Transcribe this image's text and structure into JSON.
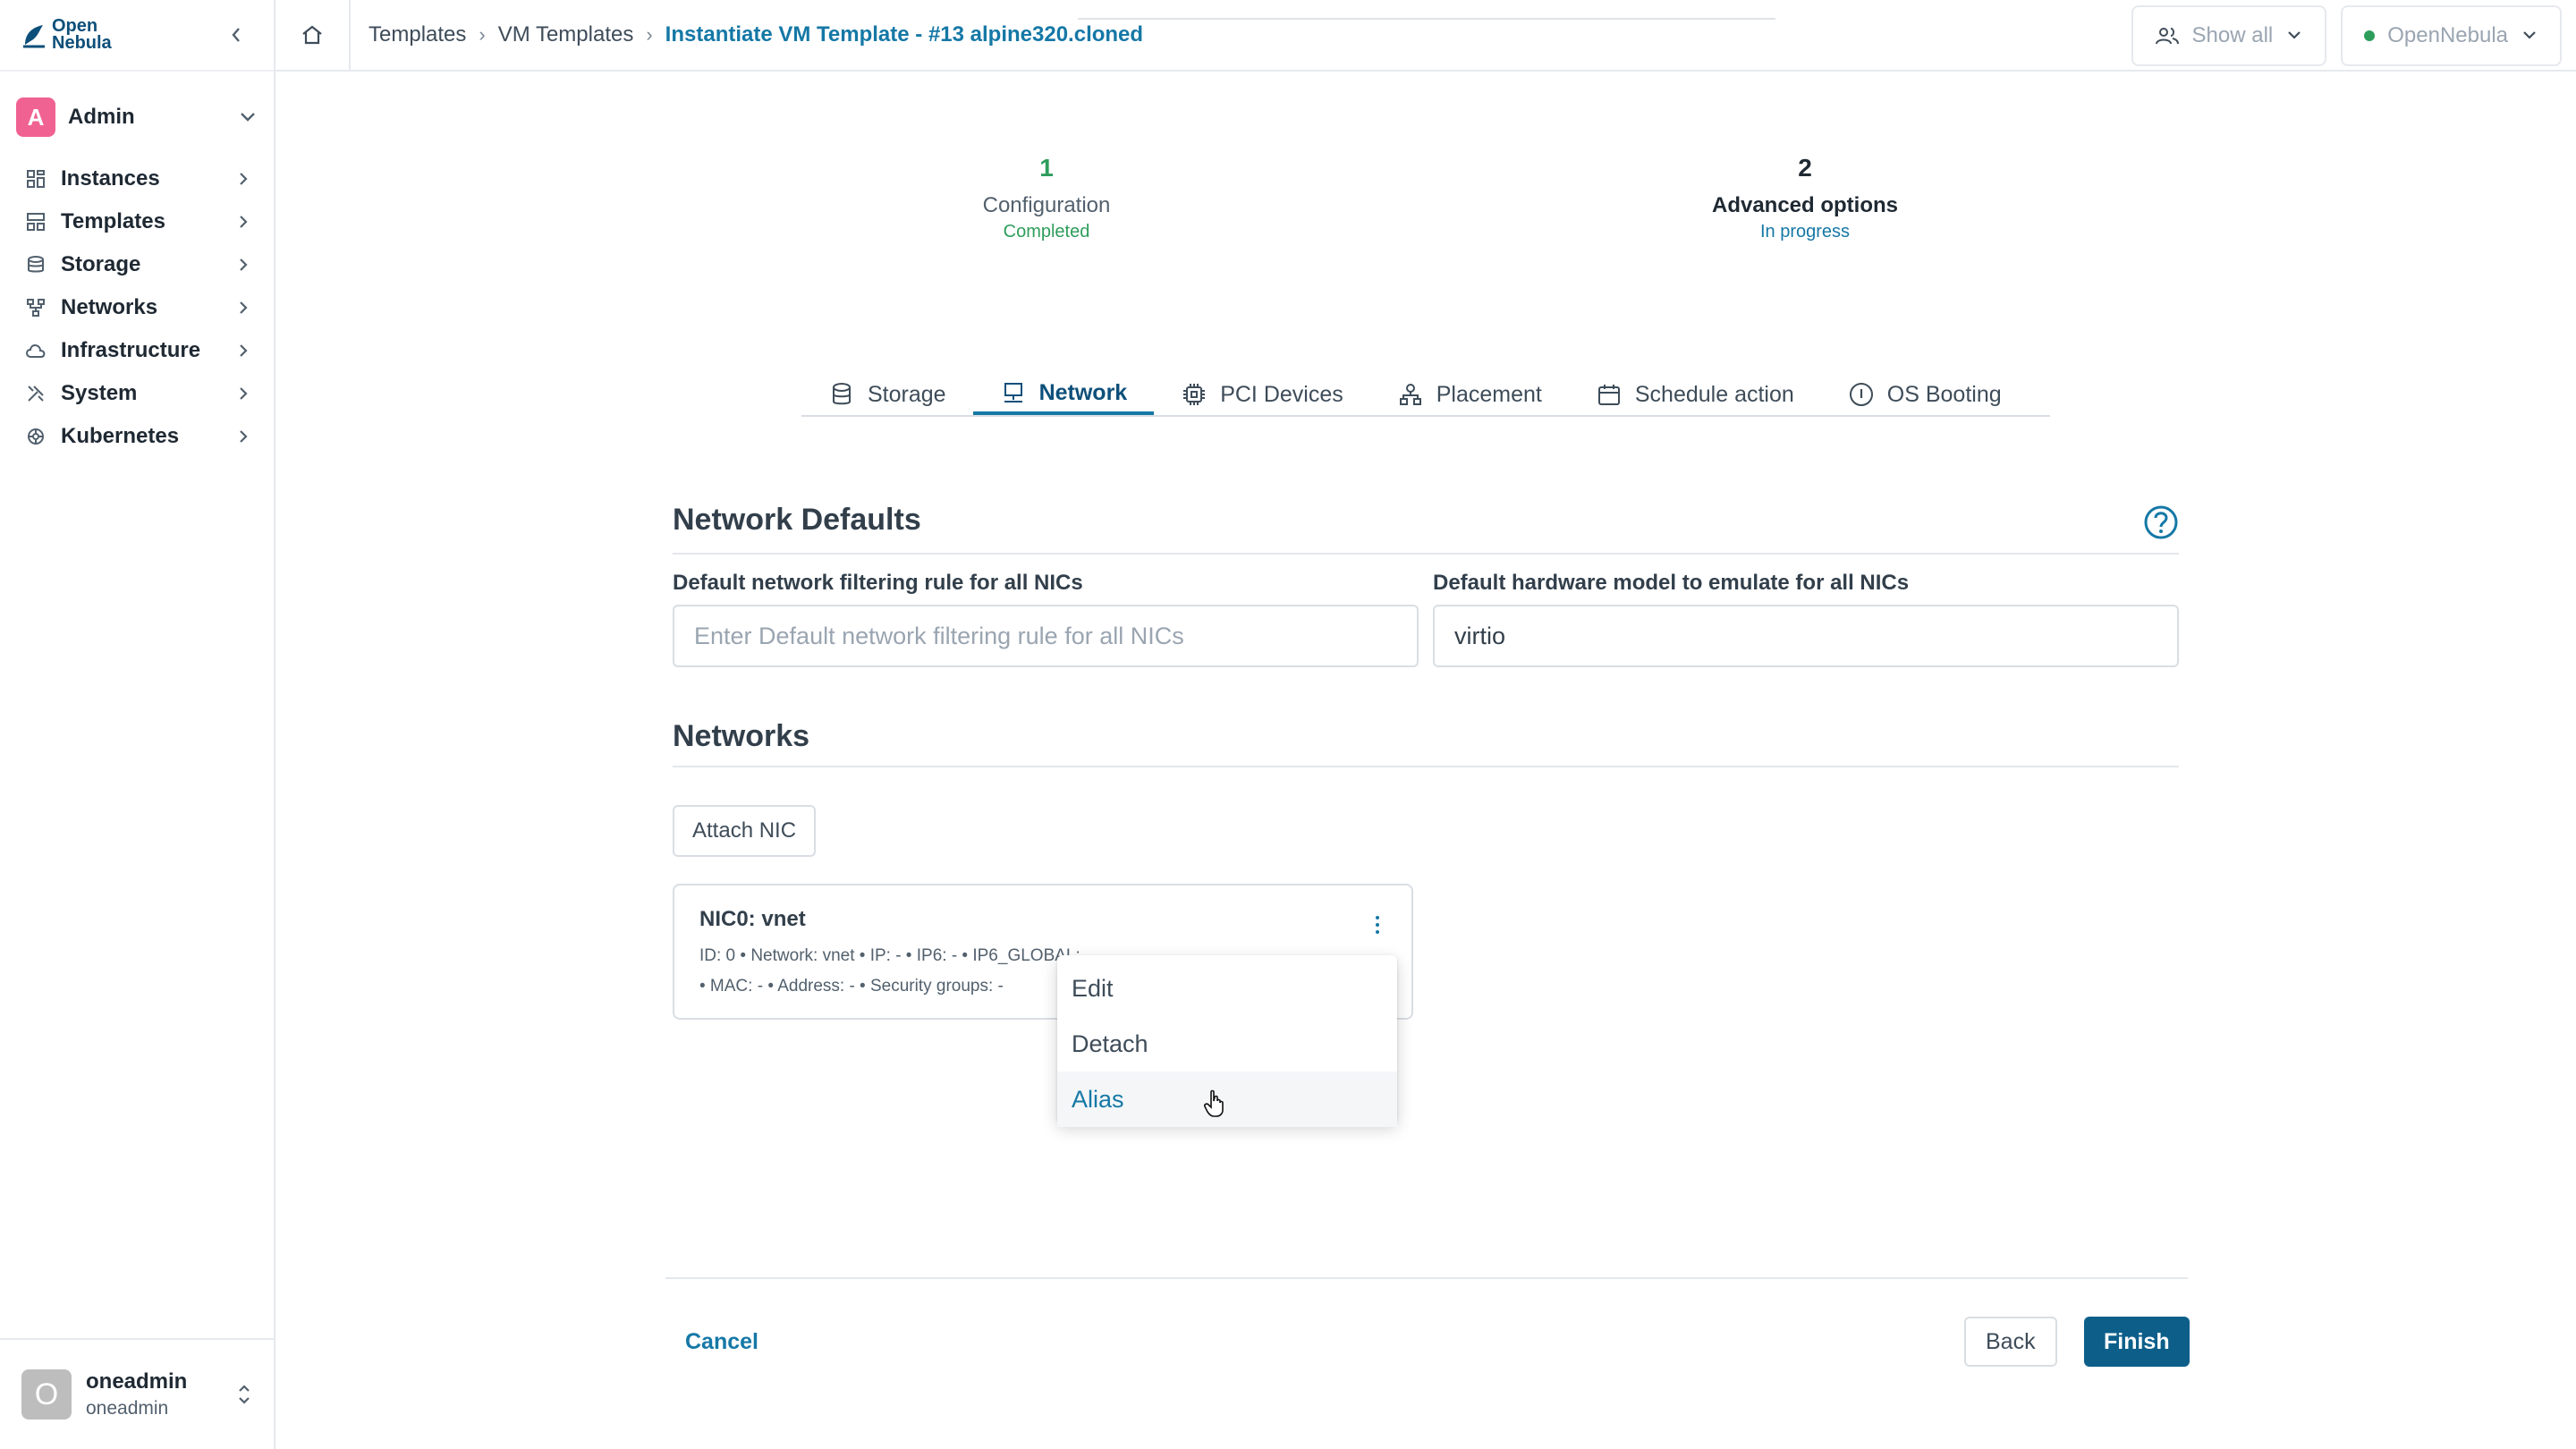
{
  "app": {
    "logo_line1": "Open",
    "logo_line2": "Nebula"
  },
  "sidebar": {
    "group": {
      "initial": "A",
      "name": "Admin"
    },
    "items": [
      {
        "label": "Instances",
        "icon": "grid-icon"
      },
      {
        "label": "Templates",
        "icon": "layout-icon"
      },
      {
        "label": "Storage",
        "icon": "database-icon"
      },
      {
        "label": "Networks",
        "icon": "network-icon"
      },
      {
        "label": "Infrastructure",
        "icon": "cloud-icon"
      },
      {
        "label": "System",
        "icon": "tools-icon"
      },
      {
        "label": "Kubernetes",
        "icon": "helm-icon"
      }
    ],
    "user": {
      "initial": "O",
      "name": "oneadmin",
      "group": "oneadmin"
    }
  },
  "header": {
    "breadcrumb": [
      "Templates",
      "VM Templates",
      "Instantiate VM Template - #13 alpine320.cloned"
    ],
    "view_filter": "Show all",
    "zone": "OpenNebula",
    "zone_status_color": "#2e9d5b"
  },
  "stepper": {
    "steps": [
      {
        "number": "1",
        "title": "Configuration",
        "status": "Completed"
      },
      {
        "number": "2",
        "title": "Advanced options",
        "status": "In progress"
      }
    ]
  },
  "tabs": [
    {
      "label": "Storage",
      "icon": "database-icon"
    },
    {
      "label": "Network",
      "icon": "monitor-network-icon",
      "active": true
    },
    {
      "label": "PCI Devices",
      "icon": "chip-icon"
    },
    {
      "label": "Placement",
      "icon": "hierarchy-icon"
    },
    {
      "label": "Schedule action",
      "icon": "calendar-icon"
    },
    {
      "label": "OS Booting",
      "icon": "info-circle-icon"
    }
  ],
  "network_defaults": {
    "title": "Network Defaults",
    "filter_label": "Default network filtering rule for all NICs",
    "filter_placeholder": "Enter Default network filtering rule for all NICs",
    "filter_value": "",
    "model_label": "Default hardware model to emulate for all NICs",
    "model_value": "virtio"
  },
  "networks": {
    "title": "Networks",
    "attach_label": "Attach NIC",
    "nics": [
      {
        "title": "NIC0: vnet",
        "line1": "ID: 0 • Network: vnet • IP: - • IP6: - • IP6_GLOBAL: - • IP6_ULA: -",
        "line2": "• MAC: - • Address: - • Security groups: -"
      }
    ]
  },
  "context_menu": {
    "items": [
      "Edit",
      "Detach",
      "Alias"
    ],
    "hovered": "Alias"
  },
  "footer": {
    "cancel": "Cancel",
    "back": "Back",
    "finish": "Finish"
  },
  "colors": {
    "accent": "#1578a6",
    "primary_button": "#0d5f8a",
    "success": "#2e9d5b",
    "admin_avatar": "#f06292"
  }
}
